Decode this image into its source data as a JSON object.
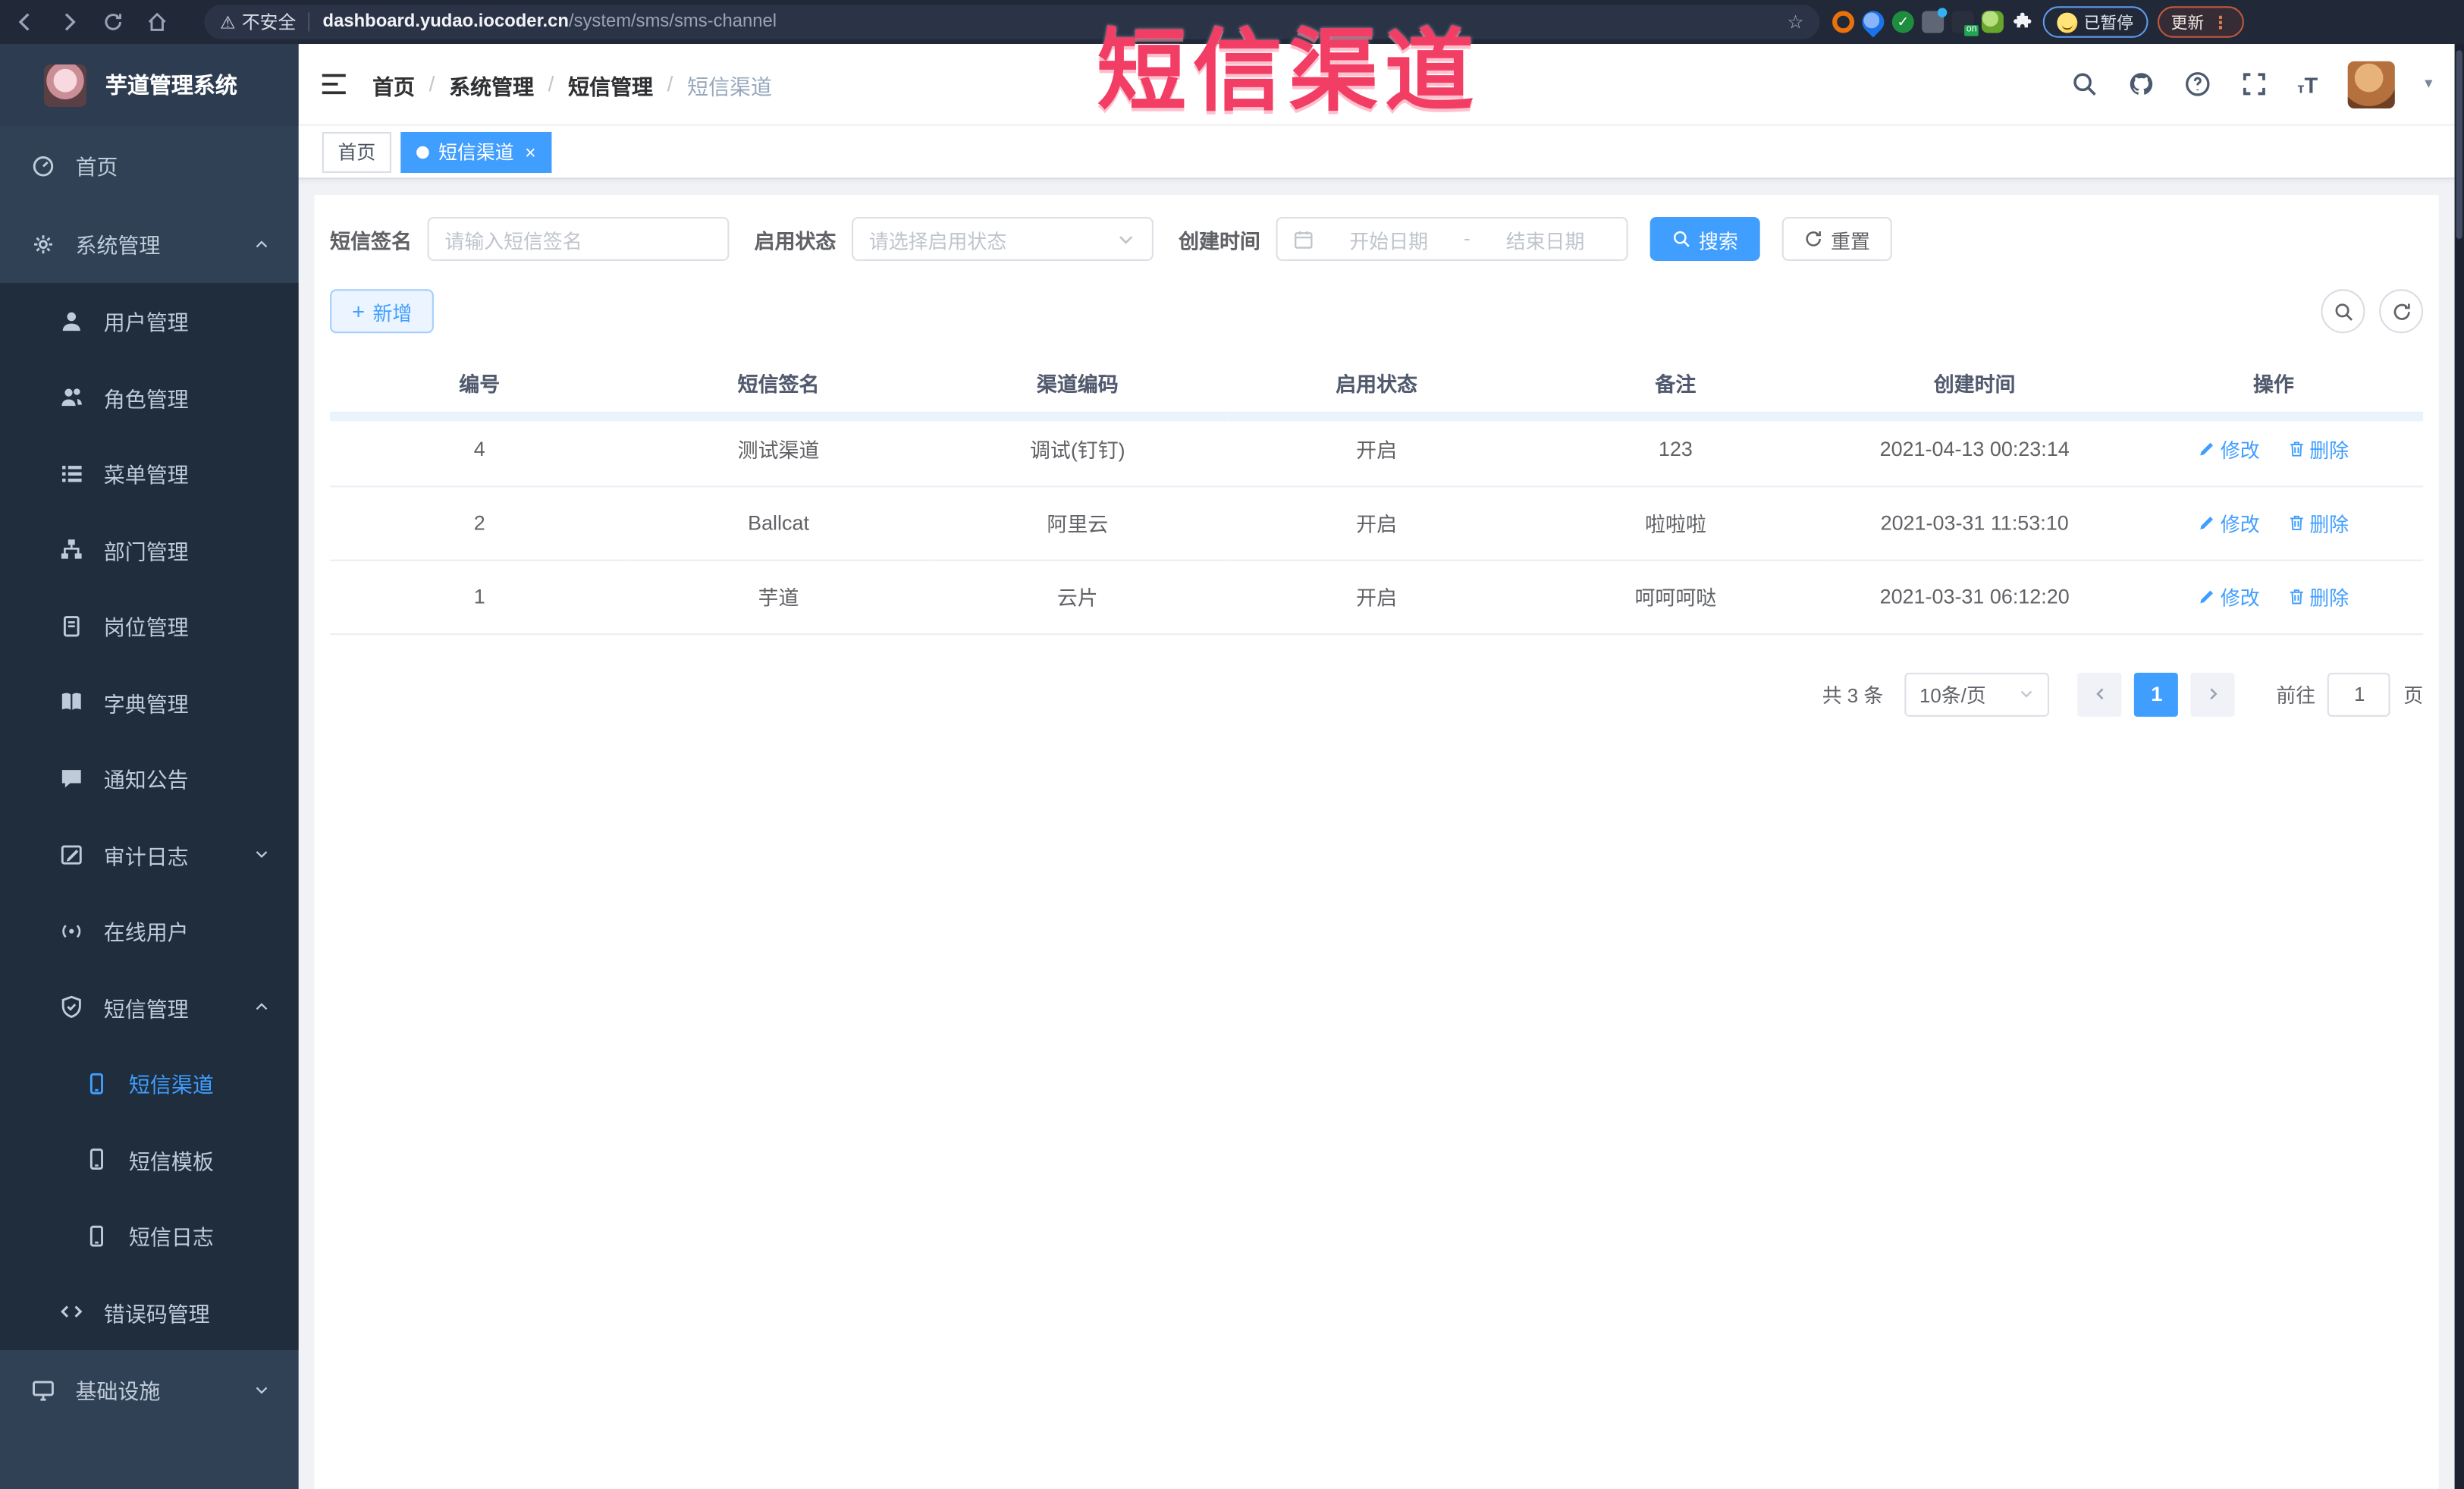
{
  "browser": {
    "security_label": "不安全",
    "url_domain": "dashboard.yudao.iocoder.cn",
    "url_path": "/system/sms/sms-channel",
    "paused_label": "已暂停",
    "update_label": "更新",
    "extension_on_badge": "on"
  },
  "watermark": "短信渠道",
  "sidebar": {
    "title": "芋道管理系统",
    "items": [
      {
        "label": "首页"
      },
      {
        "label": "系统管理"
      },
      {
        "label": "用户管理"
      },
      {
        "label": "角色管理"
      },
      {
        "label": "菜单管理"
      },
      {
        "label": "部门管理"
      },
      {
        "label": "岗位管理"
      },
      {
        "label": "字典管理"
      },
      {
        "label": "通知公告"
      },
      {
        "label": "审计日志"
      },
      {
        "label": "在线用户"
      },
      {
        "label": "短信管理"
      },
      {
        "label": "短信渠道"
      },
      {
        "label": "短信模板"
      },
      {
        "label": "短信日志"
      },
      {
        "label": "错误码管理"
      },
      {
        "label": "基础设施"
      }
    ]
  },
  "header": {
    "breadcrumb": [
      {
        "label": "首页"
      },
      {
        "label": "系统管理"
      },
      {
        "label": "短信管理"
      },
      {
        "label": "短信渠道"
      }
    ],
    "separator": "/"
  },
  "tabs": {
    "home": "首页",
    "active": "短信渠道",
    "close": "×"
  },
  "filters": {
    "sign_label": "短信签名",
    "sign_placeholder": "请输入短信签名",
    "status_label": "启用状态",
    "status_placeholder": "请选择启用状态",
    "time_label": "创建时间",
    "start_placeholder": "开始日期",
    "range_separator": "-",
    "end_placeholder": "结束日期",
    "search_label": "搜索",
    "reset_label": "重置"
  },
  "toolbar": {
    "add_label": "新增",
    "plus": "+"
  },
  "table": {
    "columns": [
      "编号",
      "短信签名",
      "渠道编码",
      "启用状态",
      "备注",
      "创建时间",
      "操作"
    ],
    "edit_label": "修改",
    "delete_label": "删除",
    "rows": [
      {
        "id": "4",
        "sign": "测试渠道",
        "code": "调试(钉钉)",
        "status": "开启",
        "remark": "123",
        "created": "2021-04-13 00:23:14"
      },
      {
        "id": "2",
        "sign": "Ballcat",
        "code": "阿里云",
        "status": "开启",
        "remark": "啦啦啦",
        "created": "2021-03-31 11:53:10"
      },
      {
        "id": "1",
        "sign": "芋道",
        "code": "云片",
        "status": "开启",
        "remark": "呵呵呵哒",
        "created": "2021-03-31 06:12:20"
      }
    ]
  },
  "pagination": {
    "total_label": "共 3 条",
    "page_size": "10条/页",
    "current_page": "1",
    "goto_label": "前往",
    "goto_value": "1",
    "page_label": "页"
  },
  "icons": {
    "star": "☆",
    "warning": "⚠",
    "caret": "▾",
    "dots": "⋮"
  },
  "colors": {
    "accent": "#409EFF",
    "sidebar_bg": "#304156",
    "submenu_bg": "#1f2d3d",
    "watermark": "#f23e65",
    "browser_bar": "#212838"
  }
}
